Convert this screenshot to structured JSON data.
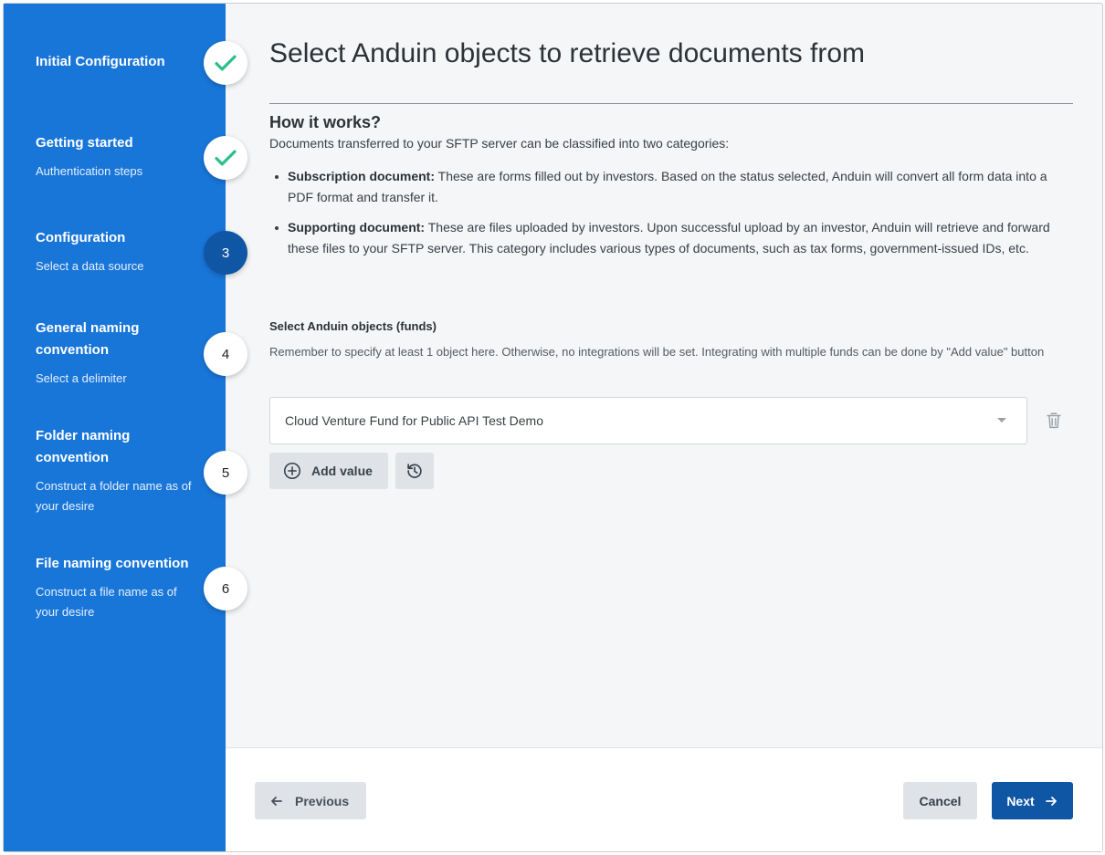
{
  "sidebar": {
    "steps": [
      {
        "title": "Initial Configuration",
        "subtitle": "",
        "badge": "",
        "state": "complete",
        "icon": "check-icon"
      },
      {
        "title": "Getting started",
        "subtitle": "Authentication steps",
        "badge": "",
        "state": "complete",
        "icon": "check-icon"
      },
      {
        "title": "Configuration",
        "subtitle": "Select a data source",
        "badge": "3",
        "state": "active"
      },
      {
        "title": "General naming convention",
        "subtitle": "Select a delimiter",
        "badge": "4",
        "state": "pending"
      },
      {
        "title": "Folder naming convention",
        "subtitle": "Construct a folder name as of your desire",
        "badge": "5",
        "state": "pending"
      },
      {
        "title": "File naming convention",
        "subtitle": "Construct a file name as of your desire",
        "badge": "6",
        "state": "pending"
      }
    ]
  },
  "main": {
    "heading": "Select Anduin objects to retrieve documents from",
    "how_title": "How it works?",
    "description": "Documents transferred to your SFTP server can be classified into two categories:",
    "bullets": [
      {
        "bold": "Subscription document:",
        "text": " These are forms filled out by investors. Based on the status selected, Anduin will convert all form data into a PDF format and transfer it."
      },
      {
        "bold": "Supporting document:",
        "text": " These are files uploaded by investors. Upon successful upload by an investor, Anduin will retrieve and forward these files to your SFTP server. This category includes various types of documents, such as tax forms, government-issued IDs, etc."
      }
    ],
    "field_label": "Select Anduin objects (funds)",
    "field_help": "Remember to specify at least 1 object here. Otherwise, no integrations will be set. Integrating with multiple funds can be done by \"Add value\" button",
    "selected_value": "Cloud Venture Fund for Public API Test Demo",
    "add_value_label": "Add value"
  },
  "footer": {
    "previous_label": "Previous",
    "cancel_label": "Cancel",
    "next_label": "Next"
  },
  "colors": {
    "sidebar_bg": "#1976d9",
    "primary": "#0f56a5",
    "check": "#2bbf8a"
  }
}
